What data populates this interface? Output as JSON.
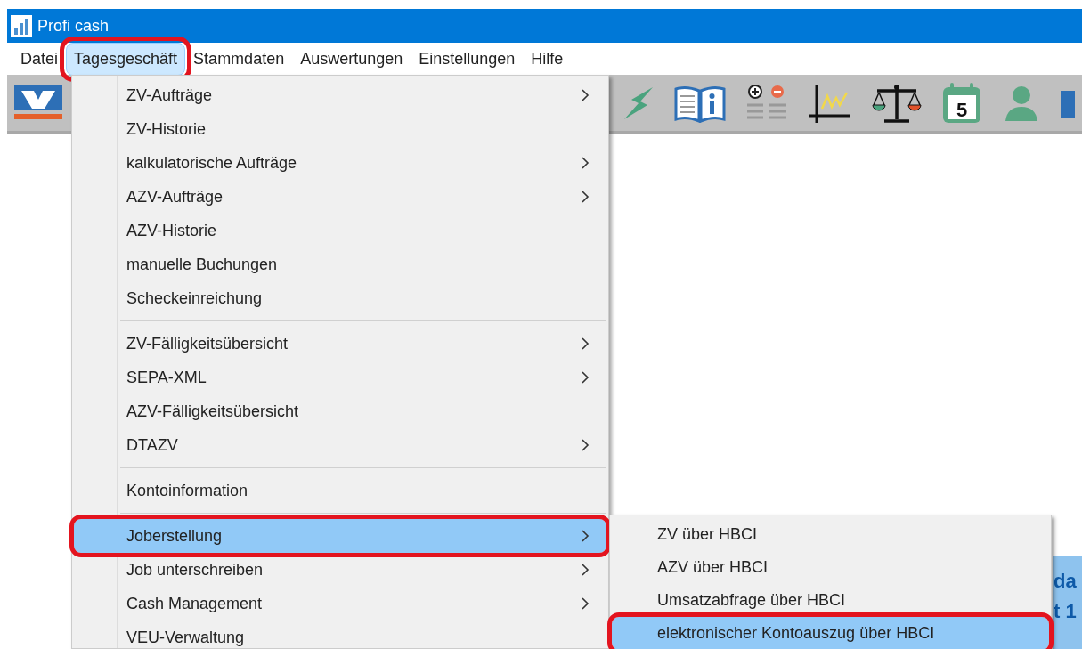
{
  "window": {
    "title": "Profi cash"
  },
  "menubar": [
    {
      "label": "Datei",
      "selected": false,
      "annotated": false
    },
    {
      "label": "Tagesgeschäft",
      "selected": true,
      "annotated": true
    },
    {
      "label": "Stammdaten",
      "selected": false,
      "annotated": false
    },
    {
      "label": "Auswertungen",
      "selected": false,
      "annotated": false
    },
    {
      "label": "Einstellungen",
      "selected": false,
      "annotated": false
    },
    {
      "label": "Hilfe",
      "selected": false,
      "annotated": false
    }
  ],
  "toolbar": {
    "calendar_day": "5"
  },
  "menu": [
    {
      "kind": "item",
      "label": "ZV-Aufträge",
      "submenu": true,
      "selected": false,
      "annotated": false
    },
    {
      "kind": "item",
      "label": "ZV-Historie",
      "submenu": false,
      "selected": false,
      "annotated": false
    },
    {
      "kind": "item",
      "label": "kalkulatorische Aufträge",
      "submenu": true,
      "selected": false,
      "annotated": false
    },
    {
      "kind": "item",
      "label": "AZV-Aufträge",
      "submenu": true,
      "selected": false,
      "annotated": false
    },
    {
      "kind": "item",
      "label": "AZV-Historie",
      "submenu": false,
      "selected": false,
      "annotated": false
    },
    {
      "kind": "item",
      "label": "manuelle Buchungen",
      "submenu": false,
      "selected": false,
      "annotated": false
    },
    {
      "kind": "item",
      "label": "Scheckeinreichung",
      "submenu": false,
      "selected": false,
      "annotated": false
    },
    {
      "kind": "separator"
    },
    {
      "kind": "item",
      "label": "ZV-Fälligkeitsübersicht",
      "submenu": true,
      "selected": false,
      "annotated": false
    },
    {
      "kind": "item",
      "label": "SEPA-XML",
      "submenu": true,
      "selected": false,
      "annotated": false
    },
    {
      "kind": "item",
      "label": "AZV-Fälligkeitsübersicht",
      "submenu": false,
      "selected": false,
      "annotated": false
    },
    {
      "kind": "item",
      "label": "DTAZV",
      "submenu": true,
      "selected": false,
      "annotated": false
    },
    {
      "kind": "separator"
    },
    {
      "kind": "item",
      "label": "Kontoinformation",
      "submenu": false,
      "selected": false,
      "annotated": false
    },
    {
      "kind": "separator"
    },
    {
      "kind": "item",
      "label": "Joberstellung",
      "submenu": true,
      "selected": true,
      "annotated": true
    },
    {
      "kind": "item",
      "label": "Job unterschreiben",
      "submenu": true,
      "selected": false,
      "annotated": false
    },
    {
      "kind": "item",
      "label": "Cash Management",
      "submenu": true,
      "selected": false,
      "annotated": false
    },
    {
      "kind": "item",
      "label": "VEU-Verwaltung",
      "submenu": false,
      "selected": false,
      "annotated": false
    }
  ],
  "submenu": [
    {
      "label": "ZV über HBCI",
      "selected": false,
      "annotated": false
    },
    {
      "label": "AZV über HBCI",
      "selected": false,
      "annotated": false
    },
    {
      "label": "Umsatzabfrage über HBCI",
      "selected": false,
      "annotated": false
    },
    {
      "label": "elektronischer Kontoauszug über HBCI",
      "selected": true,
      "annotated": true
    }
  ],
  "background_panel": {
    "lines": [
      "da",
      "t 1"
    ]
  }
}
